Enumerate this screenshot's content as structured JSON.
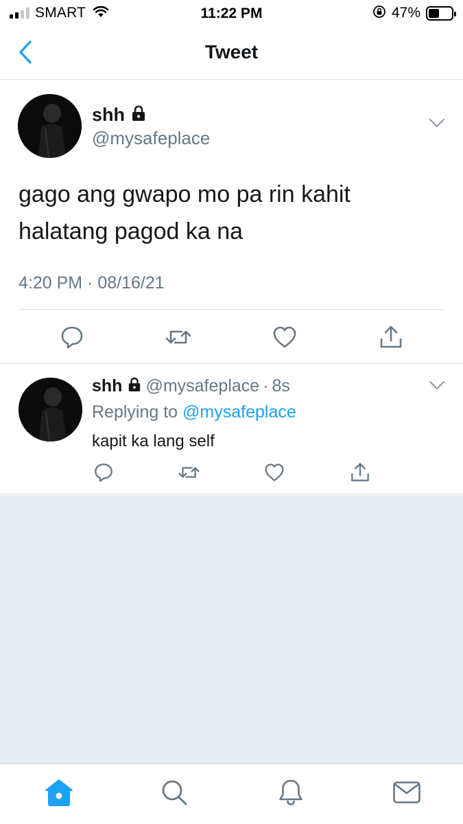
{
  "status_bar": {
    "carrier": "SMART",
    "time": "11:22 PM",
    "battery_percent": "47%",
    "battery_level": 0.47,
    "signal_bars_active": 2,
    "signal_bars_total": 4,
    "icons": [
      "signal-icon",
      "wifi-icon",
      "orientation-lock-icon",
      "battery-icon"
    ]
  },
  "header": {
    "title": "Tweet",
    "back_icon": "chevron-left-icon"
  },
  "main_tweet": {
    "author_name": "shh",
    "author_handle": "@mysafeplace",
    "protected_icon": "lock-icon",
    "text_line_1": "gago ang gwapo mo pa rin kahit",
    "text_line_2": "halatang pagod ka na",
    "timestamp": "4:20 PM · 08/16/21",
    "actions": [
      "reply-icon",
      "retweet-icon",
      "like-icon",
      "share-icon"
    ]
  },
  "reply": {
    "author_name": "shh",
    "author_handle": "@mysafeplace",
    "separator": "·",
    "time_ago": "8s",
    "replying_prefix": "Replying to",
    "replying_to": "@mysafeplace",
    "text": "kapit ka lang self",
    "actions": [
      "reply-icon",
      "retweet-icon",
      "like-icon",
      "share-icon"
    ]
  },
  "tab_bar": {
    "tabs": [
      "home-icon",
      "search-icon",
      "notifications-icon",
      "messages-icon"
    ],
    "active_tab": "home-icon"
  },
  "colors": {
    "accent": "#1da1f2",
    "secondary_text": "#657786",
    "primary_text": "#14171a",
    "divider": "#d9dde2",
    "empty_background": "#e6ecf0"
  }
}
